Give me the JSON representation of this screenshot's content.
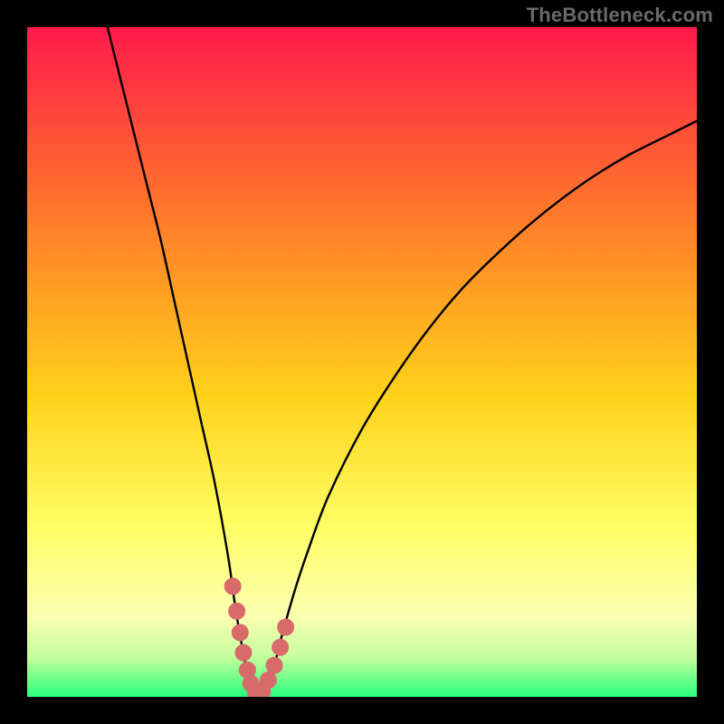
{
  "watermark": "TheBottleneck.com",
  "colors": {
    "frame_bg": "#000000",
    "gradient_top": "#ff1a4b",
    "gradient_mid1": "#ff7a2a",
    "gradient_mid2": "#ffd21a",
    "gradient_mid3": "#ffff66",
    "gradient_mid4": "#faffb0",
    "gradient_bottom1": "#c6ff9e",
    "gradient_bottom2": "#2aff7a",
    "curve": "#000000",
    "marker_fill": "#d86a6a",
    "marker_stroke": "#d86a6a"
  },
  "chart_data": {
    "type": "line",
    "title": "",
    "xlabel": "",
    "ylabel": "",
    "xlim": [
      0,
      100
    ],
    "ylim": [
      0,
      100
    ],
    "series": [
      {
        "name": "bottleneck-curve",
        "x": [
          12,
          14,
          16,
          18,
          20,
          22,
          24,
          26,
          28,
          30,
          31,
          32,
          33,
          33.5,
          34,
          35,
          36,
          37,
          38,
          40,
          42,
          45,
          50,
          55,
          60,
          65,
          70,
          75,
          80,
          85,
          90,
          95,
          100
        ],
        "values": [
          100,
          92,
          84,
          76,
          68,
          59,
          50,
          41,
          32,
          21,
          14,
          8,
          3,
          1,
          0,
          0.5,
          2,
          5,
          9,
          16,
          22,
          30,
          40,
          48,
          55,
          61,
          66,
          70.5,
          74.5,
          78,
          81,
          83.5,
          86
        ]
      }
    ],
    "markers": {
      "name": "highlight-near-min",
      "x": [
        30.7,
        31.3,
        31.8,
        32.3,
        32.9,
        33.4,
        34.1,
        35.1,
        36.0,
        36.9,
        37.8,
        38.6
      ],
      "values": [
        16.5,
        12.8,
        9.6,
        6.6,
        4.0,
        2.0,
        0.6,
        0.9,
        2.5,
        4.7,
        7.4,
        10.4
      ]
    }
  }
}
